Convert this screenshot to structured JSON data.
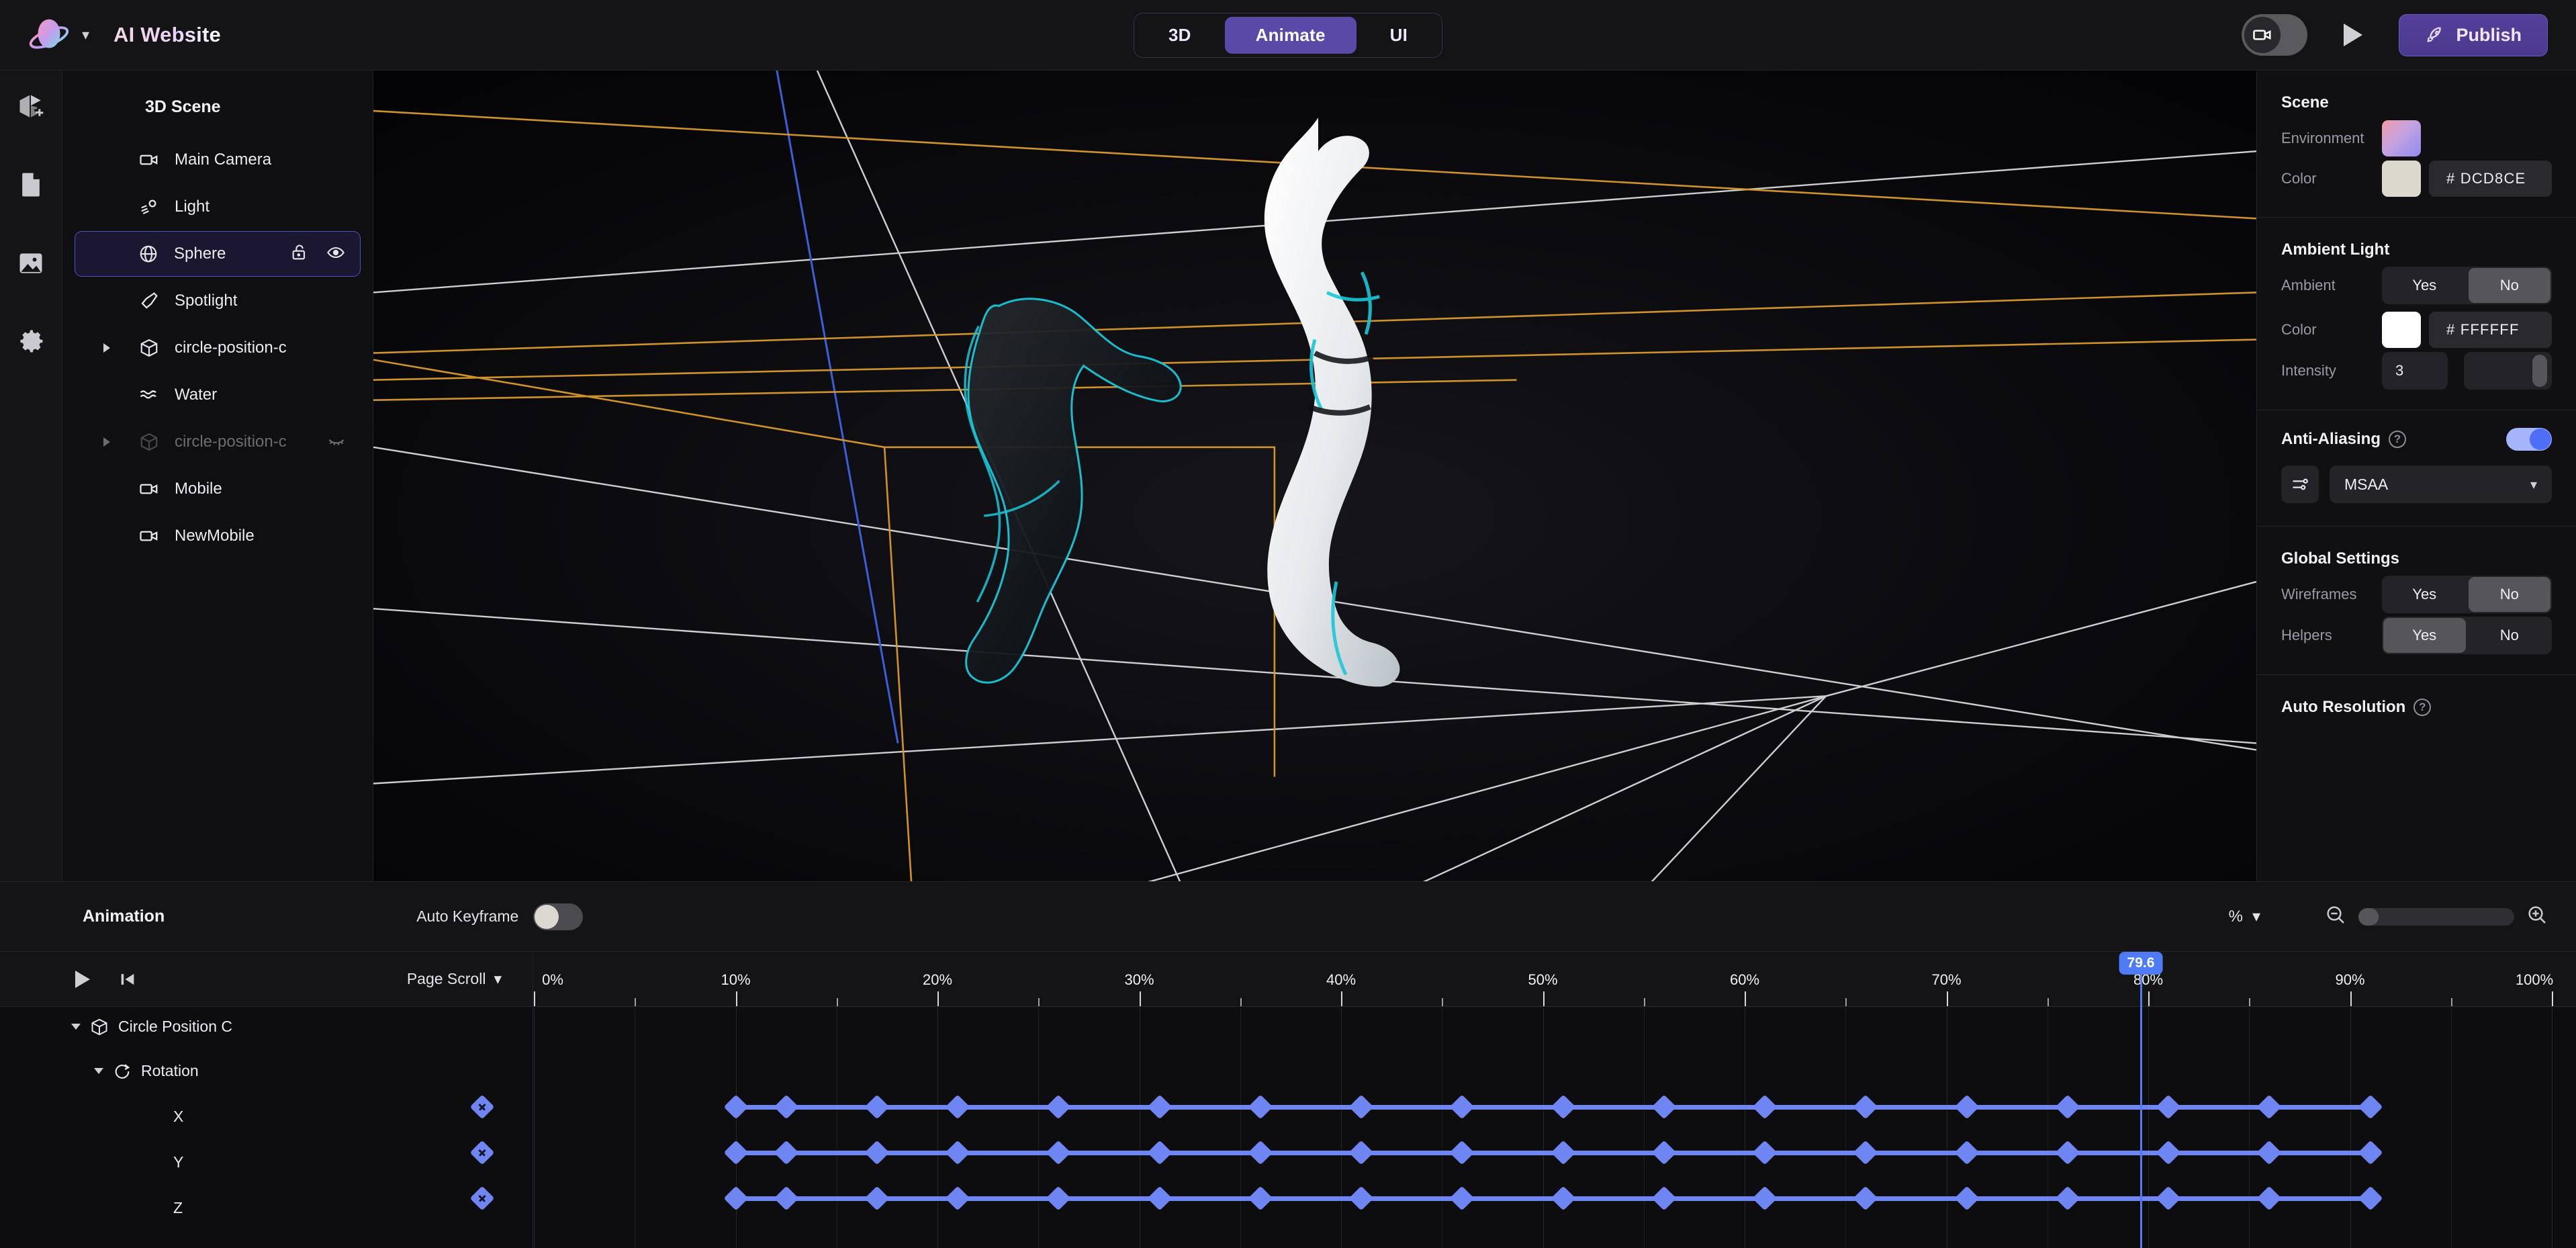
{
  "header": {
    "brand_title": "AI Website",
    "brand_caret_icon": "chevron-down-icon",
    "logo_icon": "planet-logo-icon",
    "mode_tabs": [
      {
        "label": "3D",
        "active": false
      },
      {
        "label": "Animate",
        "active": true
      },
      {
        "label": "UI",
        "active": false
      }
    ],
    "camera_toggle_icon": "video-camera-icon",
    "preview_play_icon": "play-icon",
    "publish_label": "Publish",
    "publish_icon": "rocket-icon",
    "accent_color": "#5b49a8"
  },
  "rail": {
    "items": [
      {
        "icon": "add-cube-icon",
        "name": "add-object"
      },
      {
        "icon": "file-icon",
        "name": "pages"
      },
      {
        "icon": "image-icon",
        "name": "assets"
      },
      {
        "icon": "gear-icon",
        "name": "settings"
      }
    ]
  },
  "scene_tree": {
    "title": "3D Scene",
    "items": [
      {
        "label": "Main Camera",
        "icon": "video-camera-icon",
        "expandable": false,
        "selected": false,
        "dimmed": false,
        "actions": []
      },
      {
        "label": "Light",
        "icon": "light-icon",
        "expandable": false,
        "selected": false,
        "dimmed": false,
        "actions": []
      },
      {
        "label": "Sphere",
        "icon": "globe-icon",
        "expandable": false,
        "selected": true,
        "dimmed": false,
        "actions": [
          "unlock-icon",
          "eye-icon"
        ]
      },
      {
        "label": "Spotlight",
        "icon": "spotlight-icon",
        "expandable": false,
        "selected": false,
        "dimmed": false,
        "actions": []
      },
      {
        "label": "circle-position-c",
        "icon": "cube-icon",
        "expandable": true,
        "selected": false,
        "dimmed": false,
        "actions": []
      },
      {
        "label": "Water",
        "icon": "waves-icon",
        "expandable": false,
        "selected": false,
        "dimmed": false,
        "actions": []
      },
      {
        "label": "circle-position-c",
        "icon": "cube-icon",
        "expandable": true,
        "selected": false,
        "dimmed": true,
        "actions": [
          "eye-off-icon"
        ]
      },
      {
        "label": "Mobile",
        "icon": "video-camera-icon",
        "expandable": false,
        "selected": false,
        "dimmed": false,
        "actions": []
      },
      {
        "label": "NewMobile",
        "icon": "video-camera-icon",
        "expandable": false,
        "selected": false,
        "dimmed": false,
        "actions": []
      }
    ]
  },
  "properties": {
    "scene": {
      "title": "Scene",
      "environment_label": "Environment",
      "environment_swatch": "gradient-pink-purple",
      "color_label": "Color",
      "color_hex": "# DCD8CE",
      "color_swatch": "#DCD8CE"
    },
    "ambient_light": {
      "title": "Ambient Light",
      "ambient_label": "Ambient",
      "ambient_yes": "Yes",
      "ambient_no": "No",
      "ambient_value": "No",
      "color_label": "Color",
      "color_hex": "# FFFFFF",
      "color_swatch": "#FFFFFF",
      "intensity_label": "Intensity",
      "intensity_value": "3"
    },
    "anti_aliasing": {
      "title": "Anti-Aliasing",
      "help_icon": "question-circle-icon",
      "enabled": true,
      "settings_icon": "sliders-icon",
      "method": "MSAA",
      "chevron_icon": "chevron-down-icon"
    },
    "global_settings": {
      "title": "Global Settings",
      "wireframes_label": "Wireframes",
      "wireframes_yes": "Yes",
      "wireframes_no": "No",
      "wireframes_value": "No",
      "helpers_label": "Helpers",
      "helpers_yes": "Yes",
      "helpers_no": "No",
      "helpers_value": "Yes"
    },
    "auto_resolution": {
      "title": "Auto Resolution",
      "help_icon": "question-circle-icon"
    }
  },
  "animation": {
    "title": "Animation",
    "auto_keyframe_label": "Auto Keyframe",
    "auto_keyframe_on": false,
    "unit_label": "%",
    "unit_chevron_icon": "chevron-down-icon",
    "zoom_out_icon": "zoom-out-icon",
    "zoom_in_icon": "zoom-in-icon",
    "zoom_value": 0
  },
  "timeline": {
    "play_icon": "play-icon",
    "go_to_start_icon": "skip-to-start-icon",
    "trigger_label": "Page Scroll",
    "trigger_chevron_icon": "chevron-down-icon",
    "ruler_labels": [
      "0%",
      "10%",
      "20%",
      "30%",
      "40%",
      "50%",
      "60%",
      "70%",
      "80%",
      "90%",
      "100%"
    ],
    "ruler_values": [
      0,
      10,
      20,
      30,
      40,
      50,
      60,
      70,
      80,
      90,
      100
    ],
    "playhead_value": 79.6,
    "playhead_chip": "79.6",
    "keyframe_color": "#6f86f2",
    "playhead_color": "#4f7bf7",
    "tracks": [
      {
        "label": "Circle Position C",
        "icon": "cube-icon",
        "depth": 0,
        "expanded": true,
        "type": "group",
        "keyframes": []
      },
      {
        "label": "Rotation",
        "icon": "rotation-icon",
        "depth": 1,
        "expanded": true,
        "type": "group",
        "keyframes": []
      },
      {
        "label": "X",
        "icon": "",
        "depth": 2,
        "type": "channel",
        "add_keyframe_at": 718,
        "keyframes": [
          10,
          12.5,
          17,
          21,
          26,
          31,
          36,
          41,
          46,
          51,
          56,
          61,
          66,
          71,
          76,
          81,
          86,
          91
        ]
      },
      {
        "label": "Y",
        "icon": "",
        "depth": 2,
        "type": "channel",
        "add_keyframe_at": 718,
        "keyframes": [
          10,
          12.5,
          17,
          21,
          26,
          31,
          36,
          41,
          46,
          51,
          56,
          61,
          66,
          71,
          76,
          81,
          86,
          91
        ]
      },
      {
        "label": "Z",
        "icon": "",
        "depth": 2,
        "type": "channel",
        "add_keyframe_at": 718,
        "keyframes": [
          10,
          12.5,
          17,
          21,
          26,
          31,
          36,
          41,
          46,
          51,
          56,
          61,
          66,
          71,
          76,
          81,
          86,
          91
        ]
      }
    ]
  },
  "viewport": {
    "background": "#050507",
    "helper_line_colors": {
      "white": "#dfdfe2",
      "orange": "#d99a2a",
      "blue": "#3b5fd9"
    },
    "figure_highlight": "#19c8d8"
  }
}
